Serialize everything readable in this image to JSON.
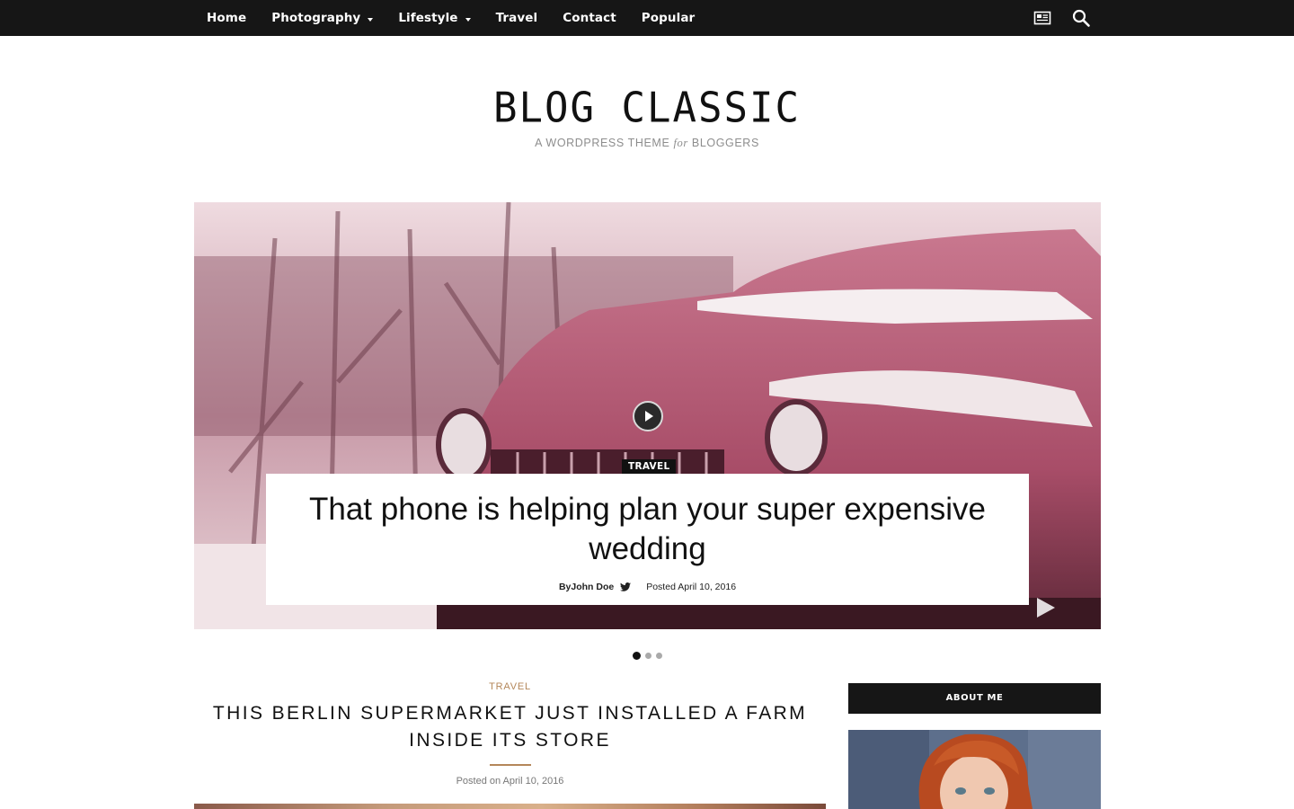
{
  "nav": {
    "items": [
      {
        "label": "Home",
        "dropdown": false
      },
      {
        "label": "Photography",
        "dropdown": true
      },
      {
        "label": "Lifestyle",
        "dropdown": true
      },
      {
        "label": "Travel",
        "dropdown": false
      },
      {
        "label": "Contact",
        "dropdown": false
      },
      {
        "label": "Popular",
        "dropdown": false
      }
    ],
    "icons": [
      "newspaper-icon",
      "search-icon"
    ]
  },
  "logo": {
    "title": "BLOG CLASSIC",
    "tagline_before": "A WORDPRESS THEME ",
    "tagline_em": "for",
    "tagline_after": " BLOGGERS"
  },
  "hero": {
    "category": "TRAVEL",
    "title": "That phone is helping plan your super expensive wedding",
    "author": "ByJohn Doe",
    "posted": "Posted April 10, 2016",
    "slides_total": 3,
    "active_slide": 1
  },
  "post": {
    "category": "TRAVEL",
    "title": "THIS BERLIN SUPERMARKET JUST INSTALLED A FARM INSIDE ITS STORE",
    "posted": "Posted on  April 10, 2016"
  },
  "sidebar": {
    "about_heading": "ABOUT ME"
  },
  "colors": {
    "topbar": "#161616",
    "accent": "#b4875a"
  }
}
